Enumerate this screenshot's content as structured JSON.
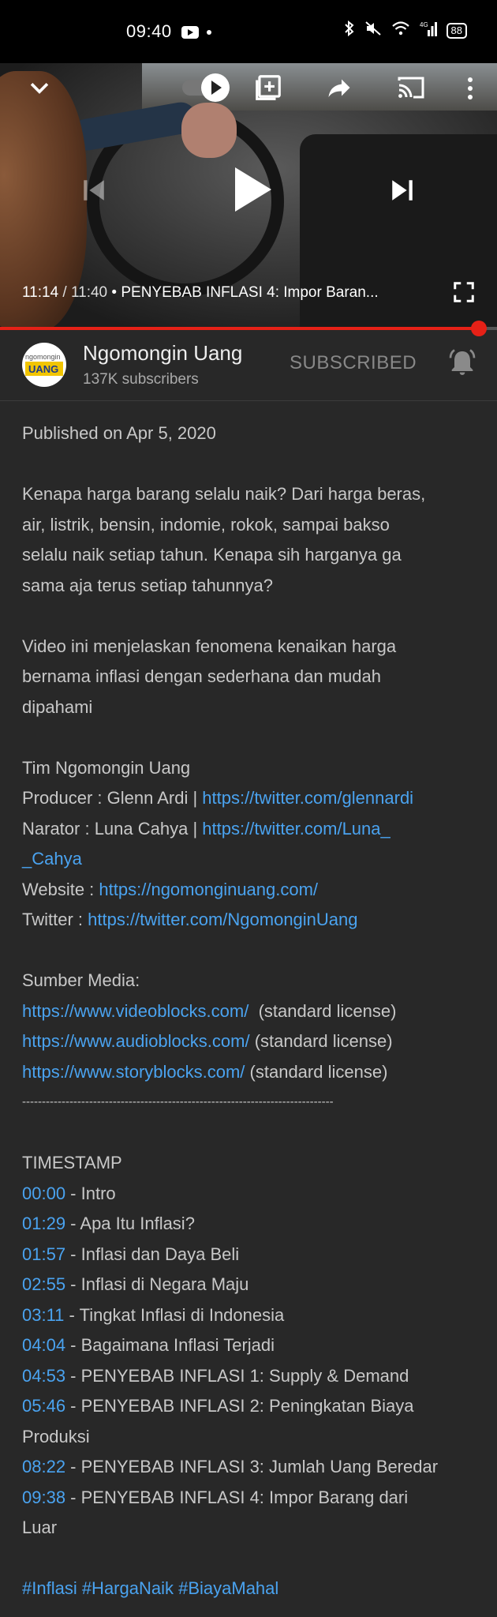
{
  "status_bar": {
    "time": "09:40",
    "battery": "88",
    "signal_label": "4G"
  },
  "player": {
    "current_time": "11:14",
    "duration": "11:40",
    "title": "PENYEBAB INFLASI 4: Impor Baran...",
    "progress": 0.963
  },
  "channel": {
    "name": "Ngomongin Uang",
    "subscribers": "137K subscribers",
    "subscribe_state": "SUBSCRIBED",
    "avatar_line1": "ngomongin",
    "avatar_line2": "UANG"
  },
  "description": {
    "published": "Published on Apr 5, 2020",
    "paragraph1": [
      "Kenapa harga barang selalu naik? Dari harga beras,",
      "air, listrik, bensin, indomie, rokok, sampai bakso",
      "selalu naik setiap tahun. Kenapa sih harganya ga",
      "sama aja terus setiap tahunnya?"
    ],
    "paragraph2": [
      "Video ini menjelaskan fenomena kenaikan harga",
      "bernama inflasi dengan sederhana dan mudah",
      "dipahami"
    ],
    "team_title": "Tim Ngomongin Uang",
    "producer_label": "Producer : Glenn Ardi | ",
    "producer_link": "https://twitter.com/glennardi",
    "narrator_label": "Narator : Luna Cahya | ",
    "narrator_link_1": "https://twitter.com/Luna_",
    "narrator_link_2": "_Cahya",
    "website_label": "Website : ",
    "website_link": "https://ngomonginuang.com/",
    "twitter_label": "Twitter : ",
    "twitter_link": "https://twitter.com/NgomonginUang",
    "media_title": "Sumber Media:",
    "media": [
      {
        "link": "https://www.videoblocks.com/",
        "note": "  (standard license)"
      },
      {
        "link": "https://www.audioblocks.com/",
        "note": " (standard license)"
      },
      {
        "link": "https://www.storyblocks.com/",
        "note": " (standard license)"
      }
    ],
    "divider": "-------------------------------------------------------------------------------",
    "timestamp_title": "TIMESTAMP",
    "timestamps": [
      {
        "time": "00:00",
        "text": " - Intro"
      },
      {
        "time": "01:29",
        "text": " - Apa Itu Inflasi?"
      },
      {
        "time": "01:57",
        "text": " - Inflasi dan Daya Beli"
      },
      {
        "time": "02:55",
        "text": " - Inflasi di Negara Maju"
      },
      {
        "time": "03:11",
        "text": " - Tingkat Inflasi di Indonesia"
      },
      {
        "time": "04:04",
        "text": " - Bagaimana Inflasi Terjadi"
      },
      {
        "time": "04:53",
        "text": " - PENYEBAB INFLASI 1: Supply & Demand"
      },
      {
        "time": "05:46",
        "text": " - PENYEBAB INFLASI 2: Peningkatan Biaya",
        "cont": "Produksi"
      },
      {
        "time": "08:22",
        "text": " - PENYEBAB INFLASI 3: Jumlah Uang Beredar"
      },
      {
        "time": "09:38",
        "text": " - PENYEBAB INFLASI 4: Impor Barang dari",
        "cont": "Luar"
      }
    ],
    "hashtags": "#Inflasi #HargaNaik #BiayaMahal"
  }
}
